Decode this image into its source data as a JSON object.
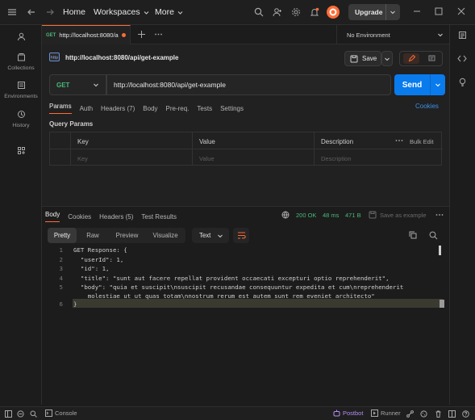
{
  "topbar": {
    "home": "Home",
    "workspaces": "Workspaces",
    "more": "More",
    "upgrade": "Upgrade",
    "brand_color": "#ff6c37"
  },
  "sidebar": {
    "items": [
      {
        "label": "",
        "icon": "account-icon"
      },
      {
        "label": "Collections",
        "icon": "collections-icon"
      },
      {
        "label": "Environments",
        "icon": "environments-icon"
      },
      {
        "label": "History",
        "icon": "history-icon"
      },
      {
        "label": "",
        "icon": "apps-icon"
      }
    ]
  },
  "tabs": {
    "active": {
      "method": "GET",
      "title": "http://localhost:8080/a"
    },
    "environment": "No Environment"
  },
  "request": {
    "breadcrumb": "http://localhost:8080/api/get-example",
    "save_label": "Save",
    "method": "GET",
    "url": "http://localhost:8080/api/get-example",
    "send_label": "Send",
    "subtabs": [
      {
        "label": "Params",
        "active": true
      },
      {
        "label": "Auth"
      },
      {
        "label": "Headers (7)"
      },
      {
        "label": "Body"
      },
      {
        "label": "Pre-req."
      },
      {
        "label": "Tests"
      },
      {
        "label": "Settings"
      }
    ],
    "cookies": "Cookies",
    "query_params_title": "Query Params",
    "table": {
      "headers": {
        "key": "Key",
        "value": "Value",
        "description": "Description",
        "bulk_edit": "Bulk Edit"
      },
      "placeholders": {
        "key": "Key",
        "value": "Value",
        "description": "Description"
      }
    }
  },
  "response": {
    "tabs": [
      {
        "label": "Body",
        "active": true
      },
      {
        "label": "Cookies"
      },
      {
        "label": "Headers (5)"
      },
      {
        "label": "Test Results"
      }
    ],
    "status": "200 OK",
    "time": "48 ms",
    "size": "471 B",
    "save_example": "Save as example",
    "view_modes": [
      "Pretty",
      "Raw",
      "Preview",
      "Visualize"
    ],
    "format": "Text",
    "status_color": "#49b87a",
    "lines": [
      {
        "n": "1",
        "text": "GET Response: {"
      },
      {
        "n": "2",
        "text": "  \"userId\": 1,"
      },
      {
        "n": "3",
        "text": "  \"id\": 1,"
      },
      {
        "n": "4",
        "text": "  \"title\": \"sunt aut facere repellat provident occaecati excepturi optio reprehenderit\","
      },
      {
        "n": "5",
        "text": "  \"body\": \"quia et suscipit\\nsuscipit recusandae consequuntur expedita et cum\\nreprehenderit"
      },
      {
        "n": "",
        "text": "    molestiae ut ut quas totam\\nnostrum rerum est autem sunt rem eveniet architecto\""
      },
      {
        "n": "6",
        "text": "}"
      }
    ]
  },
  "statusbar": {
    "console": "Console",
    "postbot": "Postbot",
    "runner": "Runner"
  }
}
